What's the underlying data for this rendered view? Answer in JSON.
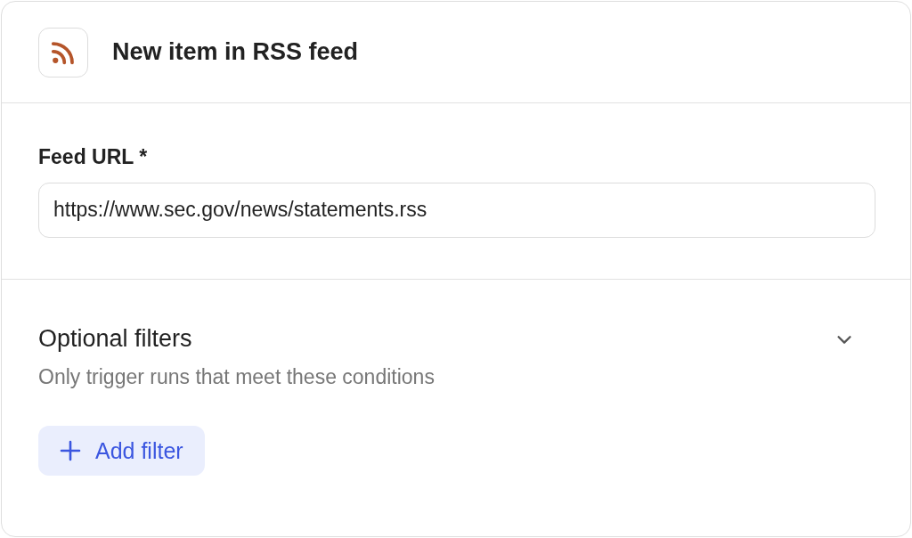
{
  "header": {
    "title": "New item in RSS feed"
  },
  "feed_url": {
    "label": "Feed URL *",
    "value": "https://www.sec.gov/news/statements.rss"
  },
  "filters": {
    "title": "Optional filters",
    "subtitle": "Only trigger runs that meet these conditions",
    "expanded": true,
    "button": "Add filter"
  }
}
